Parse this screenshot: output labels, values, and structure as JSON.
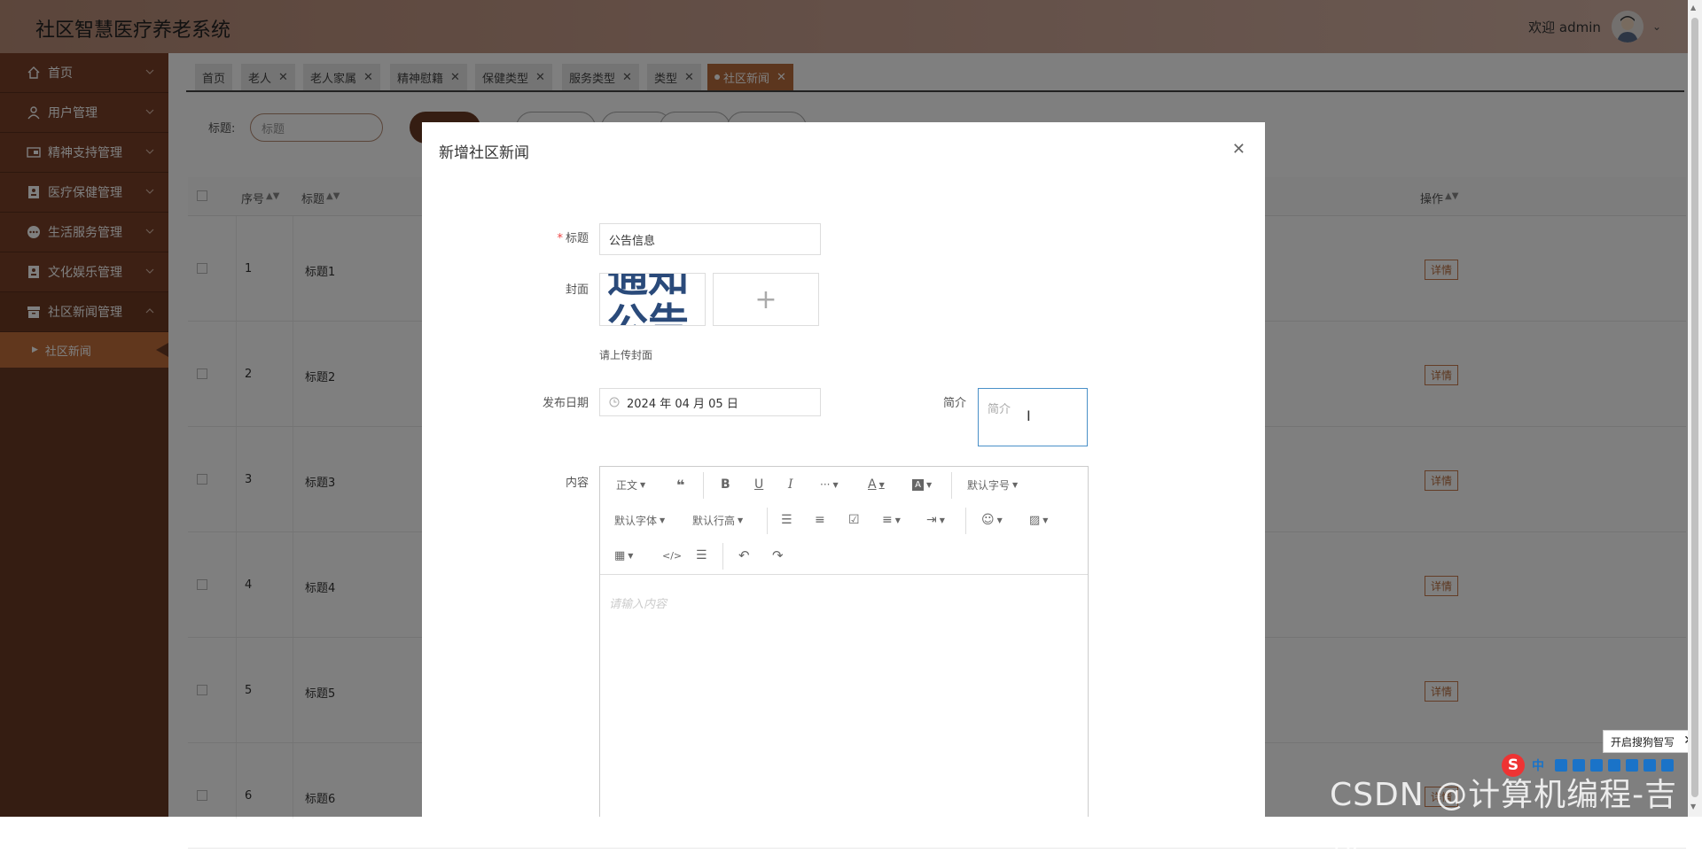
{
  "header": {
    "app_title": "社区智慧医疗养老系统",
    "welcome": "欢迎 admin"
  },
  "sidebar": {
    "items": [
      {
        "label": "首页",
        "icon": "home-icon"
      },
      {
        "label": "用户管理",
        "icon": "user-icon"
      },
      {
        "label": "精神支持管理",
        "icon": "ticket-icon"
      },
      {
        "label": "医疗保健管理",
        "icon": "id-card-icon"
      },
      {
        "label": "生活服务管理",
        "icon": "more-circle-icon"
      },
      {
        "label": "文化娱乐管理",
        "icon": "id-card-icon"
      },
      {
        "label": "社区新闻管理",
        "icon": "archive-icon"
      }
    ],
    "sub_items": [
      {
        "label": "社区新闻"
      }
    ]
  },
  "tabs": [
    {
      "label": "首页",
      "closable": false
    },
    {
      "label": "老人",
      "closable": true
    },
    {
      "label": "老人家属",
      "closable": true
    },
    {
      "label": "精神慰籍",
      "closable": true
    },
    {
      "label": "保健类型",
      "closable": true
    },
    {
      "label": "服务类型",
      "closable": true
    },
    {
      "label": "类型",
      "closable": true
    },
    {
      "label": "社区新闻",
      "closable": true,
      "active": true
    }
  ],
  "search": {
    "label": "标题:",
    "placeholder": "标题"
  },
  "table": {
    "headers": [
      "序号",
      "标题",
      "操作"
    ],
    "rows": [
      {
        "idx": "1",
        "title": "标题1",
        "op": "详情"
      },
      {
        "idx": "2",
        "title": "标题2",
        "op": "详情"
      },
      {
        "idx": "3",
        "title": "标题3",
        "op": "详情"
      },
      {
        "idx": "4",
        "title": "标题4",
        "op": "详情"
      },
      {
        "idx": "5",
        "title": "标题5",
        "op": "详情"
      },
      {
        "idx": "6",
        "title": "标题6",
        "op": "详情"
      }
    ]
  },
  "modal": {
    "title": "新增社区新闻",
    "fields": {
      "title_label": "标题",
      "title_value": "公告信息",
      "cover_label": "封面",
      "cover_text": "通知公告",
      "cover_hint": "请上传封面",
      "date_label": "发布日期",
      "date_value": "2024 年 04 月 05 日",
      "intro_label": "简介",
      "intro_placeholder": "简介",
      "content_label": "内容",
      "content_placeholder": "请输入内容"
    },
    "toolbar": {
      "paragraph": "正文",
      "font_size": "默认字号",
      "font_family": "默认字体",
      "line_height": "默认行高",
      "more": "···"
    }
  },
  "ime": {
    "tip": "开启搜狗智写",
    "logo": "S",
    "mode": "中"
  },
  "watermark": "CSDN @计算机编程-吉哥",
  "colors": {
    "sidebar_bg": "#6b3b24",
    "active_tab": "#b86c3c",
    "sub_item_active": "#c36e3b",
    "accent": "#c97a4c"
  }
}
